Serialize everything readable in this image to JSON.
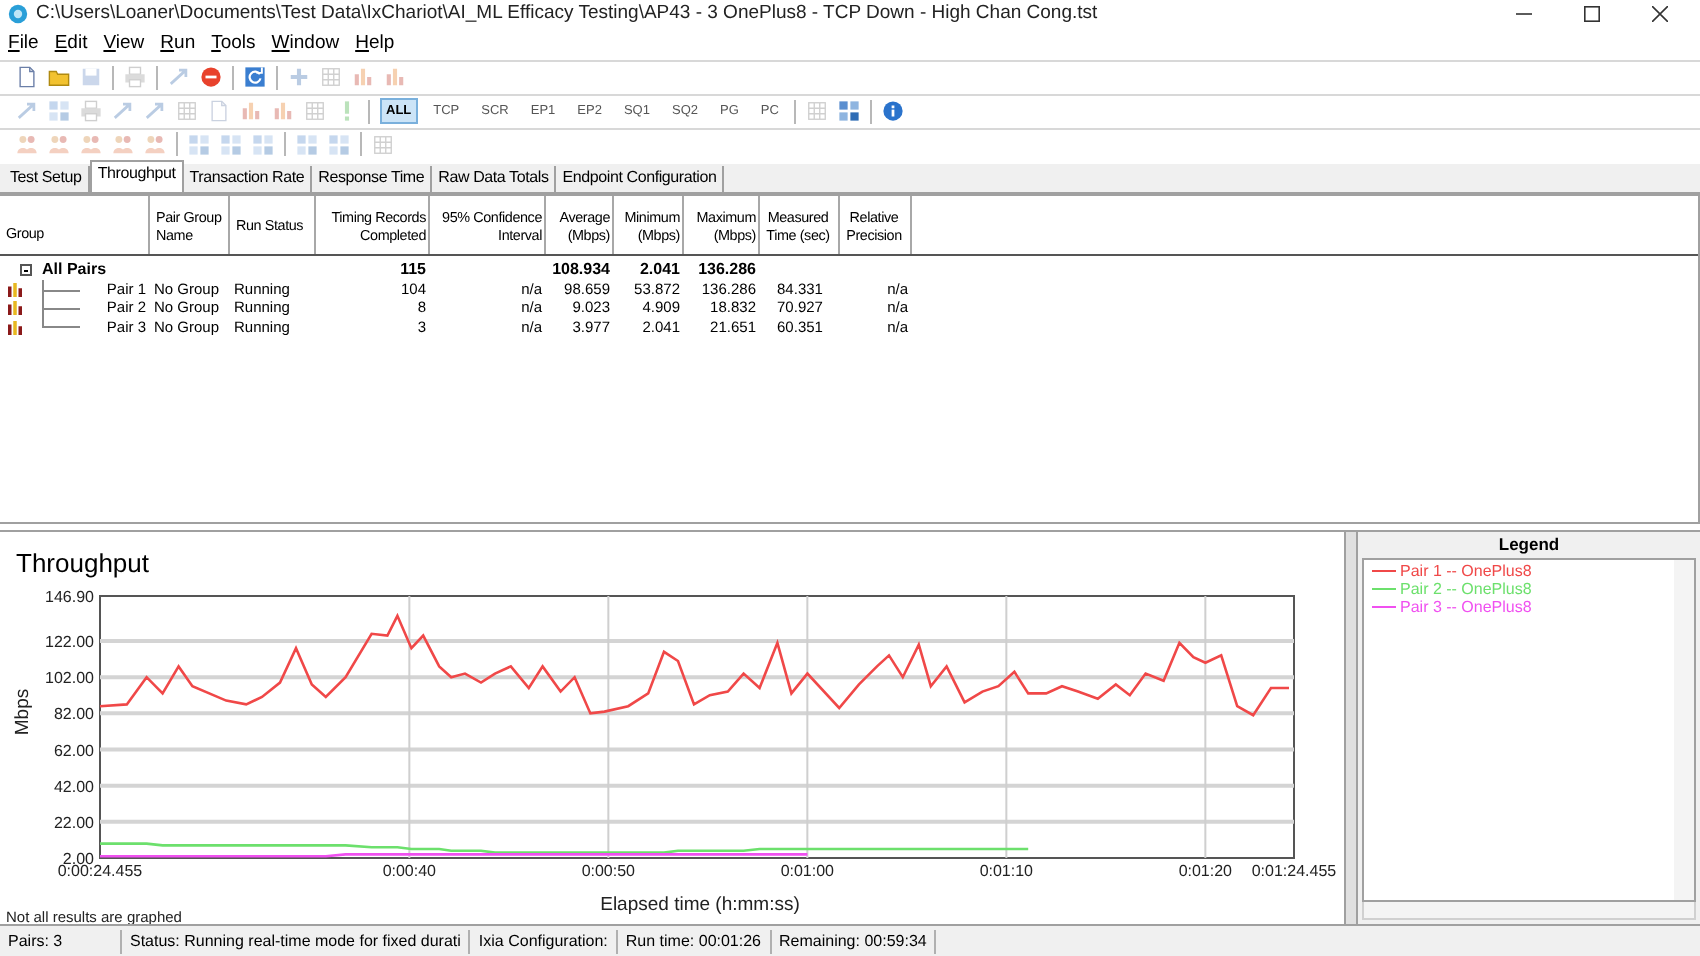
{
  "window": {
    "title": "C:\\Users\\Loaner\\Documents\\Test Data\\IxChariot\\AI_ML Efficacy Testing\\AP43 - 3 OnePlus8 - TCP Down - High Chan Cong.tst"
  },
  "menu": [
    "File",
    "Edit",
    "View",
    "Run",
    "Tools",
    "Window",
    "Help"
  ],
  "toolbars": [
    [
      {
        "kind": "doc",
        "disabled": false
      },
      {
        "kind": "folder",
        "disabled": false
      },
      {
        "kind": "disk",
        "disabled": true
      },
      {
        "kind": "sep"
      },
      {
        "kind": "printer",
        "disabled": true
      },
      {
        "kind": "sep"
      },
      {
        "kind": "arrow",
        "disabled": true
      },
      {
        "kind": "stop",
        "disabled": false
      },
      {
        "kind": "sep"
      },
      {
        "kind": "refresh",
        "disabled": false
      },
      {
        "kind": "sep"
      },
      {
        "kind": "plus",
        "disabled": true
      },
      {
        "kind": "sheet",
        "disabled": true
      },
      {
        "kind": "chart",
        "disabled": true
      },
      {
        "kind": "chart",
        "disabled": true
      }
    ],
    [
      {
        "kind": "arrow",
        "disabled": true
      },
      {
        "kind": "grid",
        "disabled": true
      },
      {
        "kind": "printer",
        "disabled": true
      },
      {
        "kind": "arrow",
        "disabled": true
      },
      {
        "kind": "arrow",
        "disabled": true
      },
      {
        "kind": "sheet",
        "disabled": true
      },
      {
        "kind": "doc",
        "disabled": true
      },
      {
        "kind": "chart",
        "disabled": true
      },
      {
        "kind": "chart",
        "disabled": true
      },
      {
        "kind": "sheet",
        "disabled": true
      },
      {
        "kind": "exclaim",
        "disabled": true
      },
      {
        "kind": "sep"
      },
      {
        "kind": "text",
        "label": "ALL",
        "selected": true
      },
      {
        "kind": "text",
        "label": "TCP",
        "selected": false
      },
      {
        "kind": "text",
        "label": "SCR",
        "selected": false
      },
      {
        "kind": "text",
        "label": "EP1",
        "selected": false
      },
      {
        "kind": "text",
        "label": "EP2",
        "selected": false
      },
      {
        "kind": "text",
        "label": "SQ1",
        "selected": false
      },
      {
        "kind": "text",
        "label": "SQ2",
        "selected": false
      },
      {
        "kind": "text",
        "label": "PG",
        "selected": false
      },
      {
        "kind": "text",
        "label": "PC",
        "selected": false
      },
      {
        "kind": "sep"
      },
      {
        "kind": "sheet",
        "disabled": true
      },
      {
        "kind": "grid",
        "disabled": false
      },
      {
        "kind": "sep"
      },
      {
        "kind": "info",
        "disabled": false
      }
    ],
    [
      {
        "kind": "people",
        "disabled": true
      },
      {
        "kind": "people",
        "disabled": true
      },
      {
        "kind": "people",
        "disabled": true
      },
      {
        "kind": "people",
        "disabled": true
      },
      {
        "kind": "people",
        "disabled": true
      },
      {
        "kind": "sep"
      },
      {
        "kind": "grid",
        "disabled": true
      },
      {
        "kind": "grid",
        "disabled": true
      },
      {
        "kind": "grid",
        "disabled": true
      },
      {
        "kind": "sep"
      },
      {
        "kind": "grid",
        "disabled": true
      },
      {
        "kind": "grid",
        "disabled": true
      },
      {
        "kind": "sep"
      },
      {
        "kind": "sheet",
        "disabled": true
      }
    ]
  ],
  "tabs": [
    {
      "label": "Test Setup",
      "selected": false
    },
    {
      "label": "Throughput",
      "selected": true
    },
    {
      "label": "Transaction Rate",
      "selected": false
    },
    {
      "label": "Response Time",
      "selected": false
    },
    {
      "label": "Raw Data Totals",
      "selected": false
    },
    {
      "label": "Endpoint Configuration",
      "selected": false
    }
  ],
  "table": {
    "columns": [
      "Group",
      "Pair Group\nName",
      "Run Status",
      "Timing Records\nCompleted",
      "95% Confidence\nInterval",
      "Average\n(Mbps)",
      "Minimum\n(Mbps)",
      "Maximum\n(Mbps)",
      "Measured\nTime (sec)",
      "Relative\nPrecision"
    ],
    "summary": {
      "label": "All Pairs",
      "expanded": true,
      "completed": "115",
      "average": "108.934",
      "minimum": "2.041",
      "maximum": "136.286"
    },
    "rows": [
      {
        "cells": [
          "Pair 1",
          "No Group",
          "Running",
          "104",
          "n/a",
          "98.659",
          "53.872",
          "136.286",
          "84.331",
          "n/a"
        ]
      },
      {
        "cells": [
          "Pair 2",
          "No Group",
          "Running",
          "8",
          "n/a",
          "9.023",
          "4.909",
          "18.832",
          "70.927",
          "n/a"
        ]
      },
      {
        "cells": [
          "Pair 3",
          "No Group",
          "Running",
          "3",
          "n/a",
          "3.977",
          "2.041",
          "21.651",
          "60.351",
          "n/a"
        ]
      }
    ]
  },
  "chart": {
    "chart_data": {
      "type": "line",
      "title": "Throughput",
      "xlabel": "Elapsed time (h:mm:ss)",
      "ylabel": "Mbps",
      "x": [
        24.455,
        25.8,
        26.8,
        27.6,
        28.4,
        29.1,
        30.8,
        31.8,
        32.6,
        33.5,
        34.3,
        35.1,
        35.8,
        36.8,
        38.1,
        38.9,
        39.4,
        40.1,
        40.7,
        41.5,
        42.1,
        42.8,
        43.6,
        44.3,
        45.1,
        46.0,
        46.7,
        47.6,
        48.3,
        49.1,
        49.8,
        51.0,
        52.0,
        52.8,
        53.5,
        54.3,
        55.1,
        56.0,
        56.8,
        57.6,
        58.5,
        59.2,
        60.0,
        61.6,
        62.6,
        63.5,
        64.1,
        64.8,
        65.6,
        66.2,
        67.0,
        67.9,
        68.8,
        69.6,
        70.4,
        71.1,
        72.0,
        72.8,
        73.6,
        74.6,
        75.5,
        76.2,
        77.0,
        77.9,
        78.7,
        79.4,
        80.0,
        80.8,
        81.6,
        82.4,
        83.3,
        84.2
      ],
      "series": [
        {
          "name": "Pair 1 -- OnePlus8",
          "color": "#f04848",
          "values": [
            86,
            87,
            102,
            93,
            108,
            97,
            89,
            87,
            91,
            99,
            118,
            98,
            91,
            102,
            126,
            125,
            136,
            118,
            125,
            108,
            102,
            104,
            99,
            104,
            108,
            96,
            108,
            94,
            102,
            82,
            83,
            86,
            93,
            116,
            111,
            87,
            92,
            94,
            104,
            96,
            121,
            93,
            104,
            85,
            98,
            108,
            114,
            102,
            120,
            97,
            108,
            88,
            94,
            97,
            105,
            93,
            93,
            97,
            94,
            90,
            98,
            92,
            104,
            100,
            121,
            113,
            110,
            114,
            86,
            81,
            96,
            96
          ]
        },
        {
          "name": "Pair 2 -- OnePlus8",
          "color": "#6ce06c",
          "values": [
            10,
            10,
            10,
            9,
            9,
            9,
            9,
            9,
            9,
            9,
            9,
            9,
            9,
            9,
            8,
            8,
            8,
            7,
            7,
            7,
            6,
            6,
            6,
            5,
            5,
            5,
            5,
            5,
            5,
            5,
            5,
            5,
            5,
            5,
            6,
            6,
            6,
            6,
            6,
            7,
            7,
            7,
            7,
            7,
            7,
            7,
            7,
            7,
            7,
            7,
            7,
            7,
            7,
            7,
            7,
            7,
            null,
            null,
            null,
            null,
            null,
            null,
            null,
            null,
            null,
            null,
            null,
            null,
            null,
            null,
            null,
            null
          ]
        },
        {
          "name": "Pair 3 -- OnePlus8",
          "color": "#f050f0",
          "values": [
            3,
            3,
            3,
            3,
            3,
            3,
            3,
            3,
            3,
            3,
            3,
            3,
            3,
            4,
            4,
            4,
            4,
            4,
            4,
            4,
            4,
            4,
            4,
            4,
            4,
            4,
            4,
            4,
            4,
            4,
            4,
            4,
            4,
            4,
            4,
            4,
            4,
            4,
            4,
            4,
            4,
            4,
            4,
            null,
            null,
            null,
            null,
            null,
            null,
            null,
            null,
            null,
            null,
            null,
            null,
            null,
            null,
            null,
            null,
            null,
            null,
            null,
            null,
            null,
            null,
            null,
            null,
            null,
            null,
            null,
            null,
            null
          ]
        }
      ],
      "xlim": [
        24.455,
        84.455
      ],
      "ylim": [
        2,
        146.9
      ],
      "grid": true,
      "xticks": [
        {
          "value": 24.455,
          "label": "0:00:24.455"
        },
        {
          "value": 40,
          "label": "0:00:40"
        },
        {
          "value": 50,
          "label": "0:00:50"
        },
        {
          "value": 60,
          "label": "0:01:00"
        },
        {
          "value": 70,
          "label": "0:01:10"
        },
        {
          "value": 80,
          "label": "0:01:20"
        },
        {
          "value": 84.455,
          "label": "0:01:24.455"
        }
      ],
      "yticks": [
        {
          "value": 2,
          "label": "2.00"
        },
        {
          "value": 22,
          "label": "22.00"
        },
        {
          "value": 42,
          "label": "42.00"
        },
        {
          "value": 62,
          "label": "62.00"
        },
        {
          "value": 82,
          "label": "82.00"
        },
        {
          "value": 102,
          "label": "102.00"
        },
        {
          "value": 122,
          "label": "122.00"
        },
        {
          "value": 146.9,
          "label": "146.90"
        }
      ]
    },
    "note": "Not all results are graphed"
  },
  "legend": {
    "title": "Legend"
  },
  "status_bar": [
    "Pairs: 3",
    "Status: Running real-time mode for fixed durati",
    "Ixia Configuration:",
    "Run time: 00:01:26",
    "Remaining: 00:59:34"
  ]
}
